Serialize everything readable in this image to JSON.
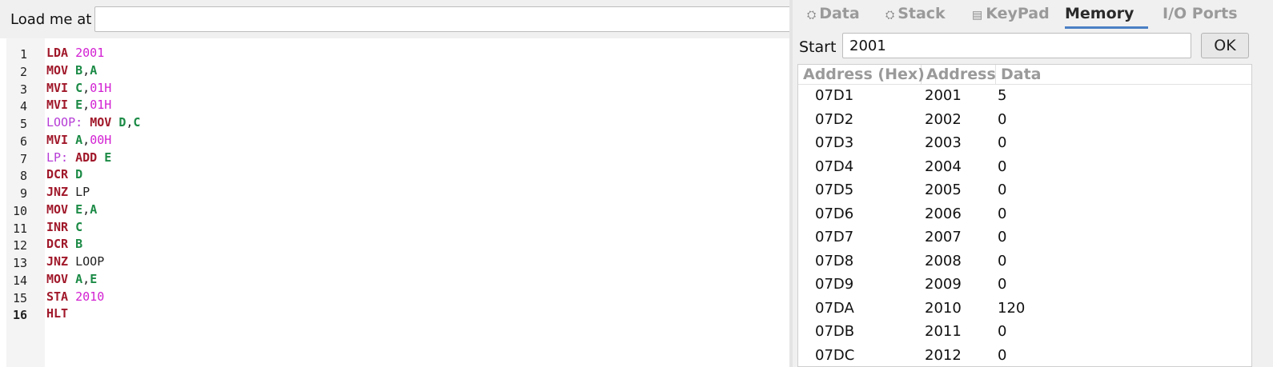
{
  "load_bar": {
    "label": "Load me at",
    "value": ""
  },
  "code_lines": [
    {
      "num": "1",
      "tokens": [
        {
          "t": "LDA",
          "k": "mnem"
        },
        {
          "t": " "
        },
        {
          "t": "2001",
          "k": "num"
        }
      ]
    },
    {
      "num": "2",
      "tokens": [
        {
          "t": "MOV",
          "k": "mnem"
        },
        {
          "t": " "
        },
        {
          "t": "B",
          "k": "reg"
        },
        {
          "t": ","
        },
        {
          "t": "A",
          "k": "reg"
        }
      ]
    },
    {
      "num": "3",
      "tokens": [
        {
          "t": "MVI",
          "k": "mnem"
        },
        {
          "t": " "
        },
        {
          "t": "C",
          "k": "reg"
        },
        {
          "t": ","
        },
        {
          "t": "01H",
          "k": "num"
        }
      ]
    },
    {
      "num": "4",
      "tokens": [
        {
          "t": "MVI",
          "k": "mnem"
        },
        {
          "t": " "
        },
        {
          "t": "E",
          "k": "reg"
        },
        {
          "t": ","
        },
        {
          "t": "01H",
          "k": "num"
        }
      ]
    },
    {
      "num": "5",
      "tokens": [
        {
          "t": "LOOP:",
          "k": "label"
        },
        {
          "t": " "
        },
        {
          "t": "MOV",
          "k": "mnem"
        },
        {
          "t": " "
        },
        {
          "t": "D",
          "k": "reg"
        },
        {
          "t": ","
        },
        {
          "t": "C",
          "k": "reg"
        }
      ]
    },
    {
      "num": "6",
      "tokens": [
        {
          "t": "MVI",
          "k": "mnem"
        },
        {
          "t": " "
        },
        {
          "t": "A",
          "k": "reg"
        },
        {
          "t": ","
        },
        {
          "t": "00H",
          "k": "num"
        }
      ]
    },
    {
      "num": "7",
      "tokens": [
        {
          "t": "LP:",
          "k": "label"
        },
        {
          "t": " "
        },
        {
          "t": "ADD",
          "k": "mnem"
        },
        {
          "t": " "
        },
        {
          "t": "E",
          "k": "reg"
        }
      ]
    },
    {
      "num": "8",
      "tokens": [
        {
          "t": "DCR",
          "k": "mnem"
        },
        {
          "t": " "
        },
        {
          "t": "D",
          "k": "reg"
        }
      ]
    },
    {
      "num": "9",
      "tokens": [
        {
          "t": "JNZ",
          "k": "mnem"
        },
        {
          "t": " "
        },
        {
          "t": "LP",
          "k": "ref"
        }
      ]
    },
    {
      "num": "10",
      "tokens": [
        {
          "t": "MOV",
          "k": "mnem"
        },
        {
          "t": " "
        },
        {
          "t": "E",
          "k": "reg"
        },
        {
          "t": ","
        },
        {
          "t": "A",
          "k": "reg"
        }
      ]
    },
    {
      "num": "11",
      "tokens": [
        {
          "t": "INR",
          "k": "mnem"
        },
        {
          "t": " "
        },
        {
          "t": "C",
          "k": "reg"
        }
      ]
    },
    {
      "num": "12",
      "tokens": [
        {
          "t": "DCR",
          "k": "mnem"
        },
        {
          "t": " "
        },
        {
          "t": "B",
          "k": "reg"
        }
      ]
    },
    {
      "num": "13",
      "tokens": [
        {
          "t": "JNZ",
          "k": "mnem"
        },
        {
          "t": " "
        },
        {
          "t": "LOOP",
          "k": "ref"
        }
      ]
    },
    {
      "num": "14",
      "tokens": [
        {
          "t": "MOV",
          "k": "mnem"
        },
        {
          "t": " "
        },
        {
          "t": "A",
          "k": "reg"
        },
        {
          "t": ","
        },
        {
          "t": "E",
          "k": "reg"
        }
      ]
    },
    {
      "num": "15",
      "tokens": [
        {
          "t": "STA",
          "k": "mnem"
        },
        {
          "t": " "
        },
        {
          "t": "2010",
          "k": "num"
        }
      ]
    },
    {
      "num": "16",
      "tokens": [
        {
          "t": "HLT",
          "k": "mnem"
        }
      ]
    }
  ],
  "active_line": "16",
  "tabs": [
    {
      "label": "Data",
      "icon": "register-icon",
      "glyph": "⛭",
      "selected": false
    },
    {
      "label": "Stack",
      "icon": "register-icon",
      "glyph": "⛭",
      "selected": false
    },
    {
      "label": "KeyPad",
      "icon": "keypad-icon",
      "glyph": "▤",
      "selected": false
    },
    {
      "label": "Memory",
      "icon": "",
      "glyph": "",
      "selected": true
    },
    {
      "label": "I/O Ports",
      "icon": "",
      "glyph": "",
      "selected": false
    }
  ],
  "memory": {
    "start_label": "Start",
    "start_value": "2001",
    "ok_label": "OK",
    "columns": [
      "Address (Hex)",
      "Address",
      "Data"
    ],
    "rows": [
      [
        "07D1",
        "2001",
        "5"
      ],
      [
        "07D2",
        "2002",
        "0"
      ],
      [
        "07D3",
        "2003",
        "0"
      ],
      [
        "07D4",
        "2004",
        "0"
      ],
      [
        "07D5",
        "2005",
        "0"
      ],
      [
        "07D6",
        "2006",
        "0"
      ],
      [
        "07D7",
        "2007",
        "0"
      ],
      [
        "07D8",
        "2008",
        "0"
      ],
      [
        "07D9",
        "2009",
        "0"
      ],
      [
        "07DA",
        "2010",
        "120"
      ],
      [
        "07DB",
        "2011",
        "0"
      ],
      [
        "07DC",
        "2012",
        "0"
      ]
    ]
  },
  "colors": {
    "mnemonic": "#a0182a",
    "register": "#1b8a45",
    "number": "#d21fd2",
    "label": "#b63cd6",
    "tab_accent": "#4a7fc4"
  }
}
